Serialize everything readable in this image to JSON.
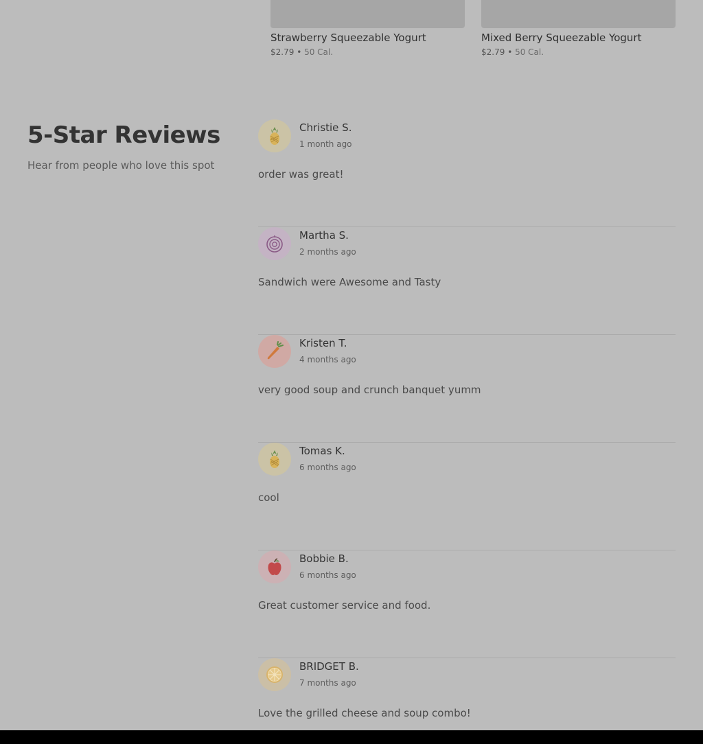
{
  "products": [
    {
      "name": "Strawberry Squeezable Yogurt",
      "price": "$2.79",
      "sep": "•",
      "calories": "50 Cal."
    },
    {
      "name": "Mixed Berry Squeezable Yogurt",
      "price": "$2.79",
      "sep": "•",
      "calories": "50 Cal."
    }
  ],
  "reviews_section": {
    "title": "5-Star Reviews",
    "subtitle": "Hear from people who love this spot"
  },
  "reviews": [
    {
      "name": "Christie S.",
      "time": "1 month ago",
      "text": "order was great!",
      "avatar": "pineapple-icon",
      "avatar_bg": "#cbc3a6"
    },
    {
      "name": "Martha S.",
      "time": "2 months ago",
      "text": "Sandwich were Awesome and Tasty",
      "avatar": "onion-icon",
      "avatar_bg": "#c4b3c4"
    },
    {
      "name": "Kristen T.",
      "time": "4 months ago",
      "text": "very good soup and crunch banquet yumm",
      "avatar": "carrot-icon",
      "avatar_bg": "#d0a9a4"
    },
    {
      "name": "Tomas K.",
      "time": "6 months ago",
      "text": "cool",
      "avatar": "pineapple-icon",
      "avatar_bg": "#cbc3a6"
    },
    {
      "name": "Bobbie B.",
      "time": "6 months ago",
      "text": "Great customer service and food.",
      "avatar": "apple-icon",
      "avatar_bg": "#ccb1b4"
    },
    {
      "name": "BRIDGET B.",
      "time": "7 months ago",
      "text": "Love the grilled cheese and soup combo!",
      "avatar": "orange-slice-icon",
      "avatar_bg": "#cbbfa6"
    }
  ]
}
